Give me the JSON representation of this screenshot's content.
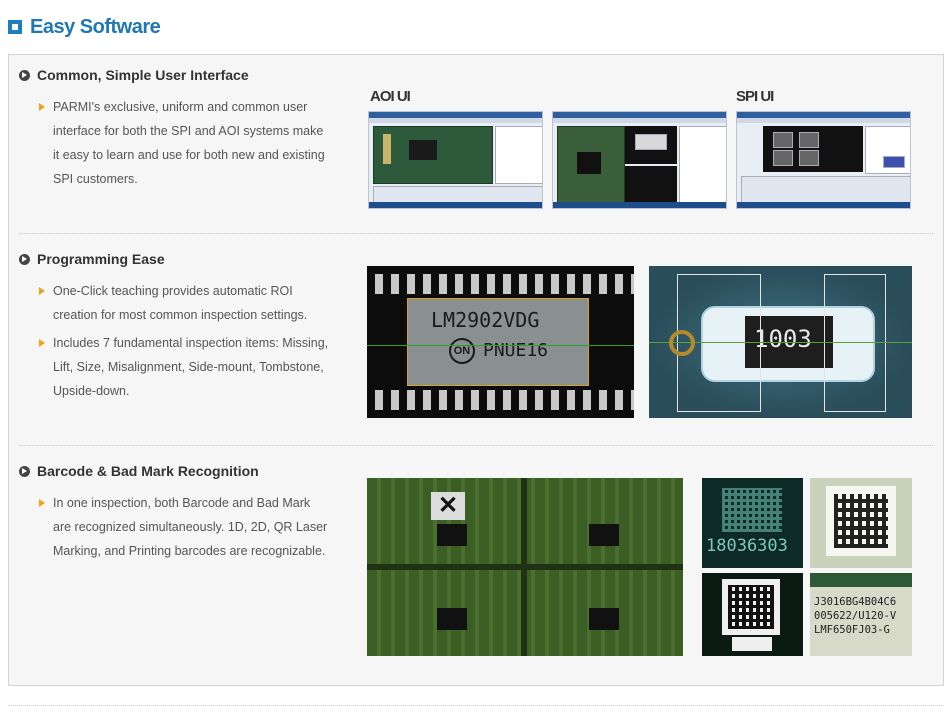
{
  "page": {
    "title": "Easy Software",
    "title_color": "#1f77b4",
    "accent": "#f0a21a"
  },
  "sections": [
    {
      "heading": "Common, Simple User Interface",
      "bullets": [
        "PARMI's exclusive, uniform and common user interface for both the SPI and AOI systems make it easy to learn and use for both new and existing SPI customers."
      ],
      "image_labels": [
        "AOI UI",
        "SPI UI"
      ]
    },
    {
      "heading": "Programming Ease",
      "bullets": [
        "One-Click teaching provides automatic ROI creation for most common inspection settings.",
        "Includes 7 fundamental inspection items: Missing, Lift, Size, Misalignment, Side-mount, Tombstone, Upside-down."
      ],
      "image_texts": [
        "LM2902VDG",
        "PNUE16",
        "ON",
        "1003"
      ]
    },
    {
      "heading": "Barcode & Bad Mark Recognition",
      "bullets": [
        "In one inspection, both Barcode and Bad Mark are recognized simultaneously. 1D, 2D, QR Laser Marking, and Printing barcodes are recognizable."
      ],
      "image_texts": [
        "18036303",
        "J3016BG4B04C6",
        "005622/U120-V",
        "LMF650FJ03-G"
      ]
    }
  ],
  "icons": [
    "title-square-icon",
    "circle-arrow-icon",
    "orange-triangle-icon"
  ]
}
